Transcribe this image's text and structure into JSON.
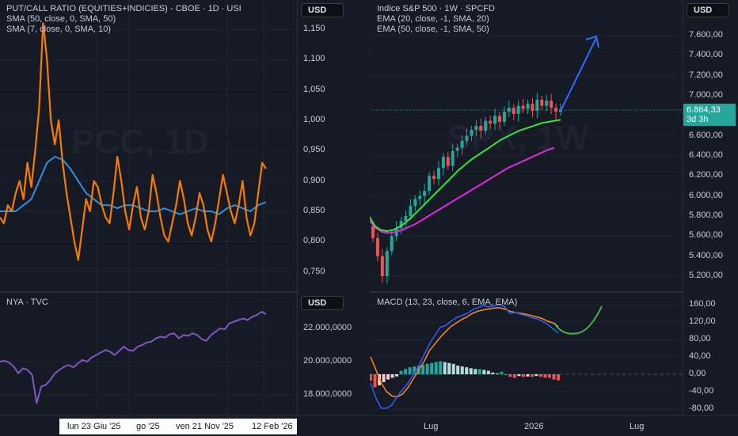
{
  "colors": {
    "bg": "#161a25",
    "orange": "#f57c00",
    "blue": "#2f8fe0",
    "purple": "#7e57c2",
    "green": "#36e636",
    "magenta": "#e02be0",
    "up": "#26a69a",
    "down": "#ef5350",
    "macd": "#2962ff",
    "signal": "#ff8a1f",
    "arrow": "#2f6bff"
  },
  "pcc": {
    "title": "PUT/CALL RATIO (EQUITIES+INDICIES) - CBOE · 1D · USI",
    "ind1": "SMA (50, close, 0, SMA, 50)",
    "ind2": "SMA (7, close, 0, SMA, 10)",
    "currency": "USD",
    "watermark": "PCC, 1D",
    "ticks": [
      "1,150",
      "1,100",
      "1,050",
      "1,000",
      "0,950",
      "0,900",
      "0,850",
      "0,800",
      "0,750"
    ],
    "tick_values": [
      1.15,
      1.1,
      1.05,
      1.0,
      0.95,
      0.9,
      0.85,
      0.8,
      0.75
    ]
  },
  "spx": {
    "title": "Indice S&P 500 · 1W · SPCFD",
    "ind1": "EMA (20, close, -1, SMA, 20)",
    "ind2": "EMA (50, close, -1, SMA, 50)",
    "currency": "USD",
    "watermark": "SPX, 1W",
    "last_price": "6.864,33",
    "countdown": "3d 3h",
    "ticks": [
      "7.600,00",
      "7.400,00",
      "7.200,00",
      "7.000,00",
      "6.600,00",
      "6.400,00",
      "6.200,00",
      "6.000,00",
      "5.800,00",
      "5.600,00",
      "5.400,00",
      "5.200,00"
    ],
    "tick_values": [
      7600,
      7400,
      7200,
      7000,
      6600,
      6400,
      6200,
      6000,
      5800,
      5600,
      5400,
      5200
    ]
  },
  "nya": {
    "title": "NYA · TVC",
    "currency": "USD",
    "ticks": [
      "22.000,0000",
      "20.000,0000",
      "18.000,0000"
    ],
    "tick_values": [
      22000,
      20000,
      18000
    ]
  },
  "macd": {
    "title": "MACD (13, 23, close, 6, EMA, EMA)",
    "ticks": [
      "160,00",
      "120,00",
      "80,00",
      "40,00",
      "0,00",
      "-40,00",
      "-80,00"
    ],
    "tick_values": [
      160,
      120,
      80,
      40,
      0,
      -40,
      -80
    ]
  },
  "time_axis": {
    "left": [
      "lun 23 Giu '25",
      "go '25",
      "ven 21 Nov '25",
      "12 Feb '26"
    ],
    "right": [
      "Lug",
      "2026",
      "Lug"
    ]
  },
  "chart_data": [
    {
      "type": "line",
      "title": "PUT/CALL RATIO (EQUITIES+INDICIES)",
      "ylim": [
        0.72,
        1.17
      ],
      "series": [
        {
          "name": "SMA (7, close, 0, SMA, 10)",
          "values": [
            0.84,
            0.83,
            0.86,
            0.85,
            0.88,
            0.9,
            0.87,
            0.93,
            0.89,
            0.95,
            1.02,
            1.16,
            1.1,
            1.0,
            0.96,
            1.0,
            0.93,
            0.88,
            0.84,
            0.8,
            0.77,
            0.82,
            0.87,
            0.85,
            0.9,
            0.89,
            0.86,
            0.84,
            0.83,
            0.88,
            0.94,
            0.9,
            0.85,
            0.82,
            0.86,
            0.89,
            0.84,
            0.82,
            0.85,
            0.91,
            0.88,
            0.84,
            0.81,
            0.8,
            0.83,
            0.86,
            0.9,
            0.87,
            0.83,
            0.81,
            0.84,
            0.88,
            0.86,
            0.82,
            0.8,
            0.83,
            0.87,
            0.91,
            0.88,
            0.85,
            0.83,
            0.86,
            0.9,
            0.84,
            0.81,
            0.83,
            0.88,
            0.93,
            0.92
          ]
        },
        {
          "name": "SMA (50, close, 0, SMA, 50)",
          "values": [
            0.85,
            0.85,
            0.85,
            0.86,
            0.87,
            0.9,
            0.93,
            0.94,
            0.935,
            0.92,
            0.9,
            0.88,
            0.87,
            0.86,
            0.86,
            0.855,
            0.86,
            0.86,
            0.855,
            0.85,
            0.85,
            0.855,
            0.85,
            0.845,
            0.85,
            0.855,
            0.85,
            0.85,
            0.845,
            0.855,
            0.86,
            0.855,
            0.85,
            0.86,
            0.865
          ]
        }
      ]
    },
    {
      "type": "candlestick",
      "title": "Indice S&P 500 1W",
      "ylim": [
        5100,
        7700
      ],
      "closes": [
        5580,
        5400,
        5200,
        5450,
        5600,
        5680,
        5750,
        5800,
        5900,
        5970,
        6000,
        6050,
        6200,
        6170,
        6280,
        6390,
        6300,
        6450,
        6480,
        6550,
        6600,
        6660,
        6700,
        6650,
        6750,
        6720,
        6800,
        6740,
        6840,
        6880,
        6820,
        6900,
        6870,
        6920,
        6850,
        6960,
        6900,
        6950,
        6880,
        6840,
        6864
      ],
      "series": [
        {
          "name": "EMA 20",
          "values": [
            5800,
            5700,
            5660,
            5650,
            5660,
            5690,
            5730,
            5780,
            5840,
            5900,
            5960,
            6020,
            6080,
            6140,
            6200,
            6260,
            6310,
            6360,
            6400,
            6440,
            6480,
            6520,
            6560,
            6590,
            6620,
            6650,
            6670,
            6690,
            6710,
            6730,
            6740,
            6750,
            6760
          ]
        },
        {
          "name": "EMA 50",
          "values": [
            5760,
            5680,
            5640,
            5630,
            5640,
            5660,
            5690,
            5720,
            5760,
            5800,
            5840,
            5880,
            5920,
            5960,
            6000,
            6040,
            6080,
            6120,
            6160,
            6200,
            6240,
            6280,
            6310,
            6340,
            6370,
            6400,
            6430,
            6460,
            6480
          ]
        }
      ]
    },
    {
      "type": "line",
      "title": "NYA",
      "ylim": [
        17500,
        23200
      ],
      "series": [
        {
          "name": "NYA",
          "values": [
            20000,
            20050,
            19950,
            19700,
            19300,
            19600,
            19500,
            19200,
            17500,
            18500,
            18600,
            18900,
            19300,
            19500,
            19700,
            19800,
            19650,
            19900,
            20100,
            20000,
            20250,
            20400,
            20550,
            20700,
            20600,
            20400,
            20650,
            20900,
            20700,
            20650,
            20900,
            21000,
            21150,
            21200,
            21400,
            21500,
            21450,
            21650,
            21700,
            21400,
            21600,
            21550,
            21700,
            21600,
            21350,
            21250,
            21600,
            21800,
            22000,
            21950,
            22300,
            22400,
            22500,
            22600,
            22500,
            22700,
            22800,
            23000,
            22850
          ]
        }
      ]
    },
    {
      "type": "bar+line",
      "title": "MACD (13, 23, close, 6, EMA, EMA)",
      "ylim": [
        -90,
        170
      ],
      "series": [
        {
          "name": "MACD",
          "values": [
            -20,
            -55,
            -78,
            -78,
            -70,
            -50,
            -35,
            -20,
            0,
            20,
            45,
            70,
            90,
            108,
            112,
            122,
            130,
            135,
            140,
            148,
            153,
            158,
            155,
            157,
            160,
            155,
            140,
            142,
            138,
            135,
            130,
            128,
            122,
            115,
            105,
            95
          ]
        },
        {
          "name": "Signal",
          "values": [
            40,
            10,
            -20,
            -40,
            -50,
            -52,
            -45,
            -30,
            -10,
            10,
            30,
            55,
            70,
            85,
            98,
            110,
            118,
            126,
            132,
            140,
            145,
            148,
            150,
            152,
            153,
            150,
            145,
            142,
            140,
            138,
            135,
            132,
            128,
            122,
            118,
            110
          ]
        },
        {
          "name": "Histogram",
          "values": [
            -15,
            -30,
            -25,
            -18,
            -12,
            -8,
            -5,
            8,
            12,
            16,
            18,
            20,
            22,
            24,
            26,
            28,
            30,
            28,
            26,
            24,
            20,
            18,
            16,
            14,
            12,
            12,
            10,
            8,
            4,
            2,
            6,
            -2,
            -6,
            -8,
            -4,
            -6,
            -5,
            -6,
            -4,
            -6,
            -8,
            -8,
            -12,
            -14
          ]
        }
      ]
    }
  ]
}
